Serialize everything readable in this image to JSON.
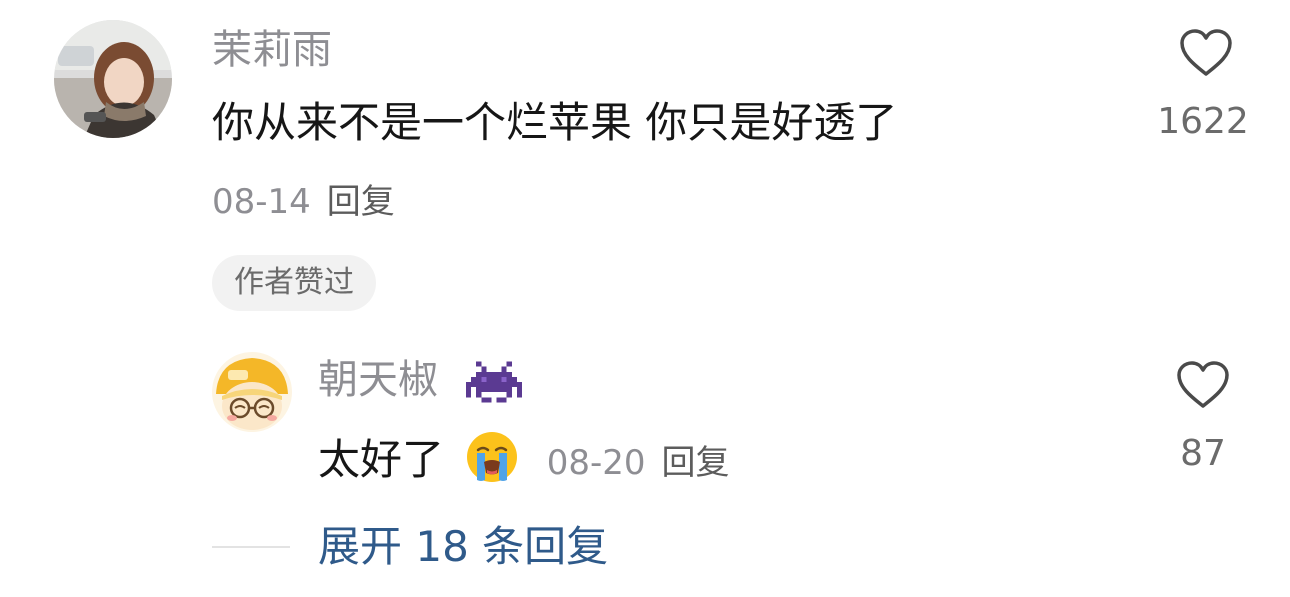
{
  "comment": {
    "username": "茉莉雨",
    "text": "你从来不是一个烂苹果 你只是好透了",
    "date": "08-14",
    "reply_label": "回复",
    "author_liked_badge": "作者赞过",
    "like_count": "1622"
  },
  "reply": {
    "username": "朝天椒",
    "text": "太好了",
    "date": "08-20",
    "reply_label": "回复",
    "like_count": "87"
  },
  "expand_replies": "展开 18 条回复",
  "icons": {
    "like": "heart-outline-icon",
    "badge": "space-invader-icon",
    "emoji": "loudly-crying-face-emoji"
  },
  "colors": {
    "secondary_text": "#8e8e93",
    "link": "#2f5a8a",
    "badge_bg": "#f2f2f2"
  }
}
